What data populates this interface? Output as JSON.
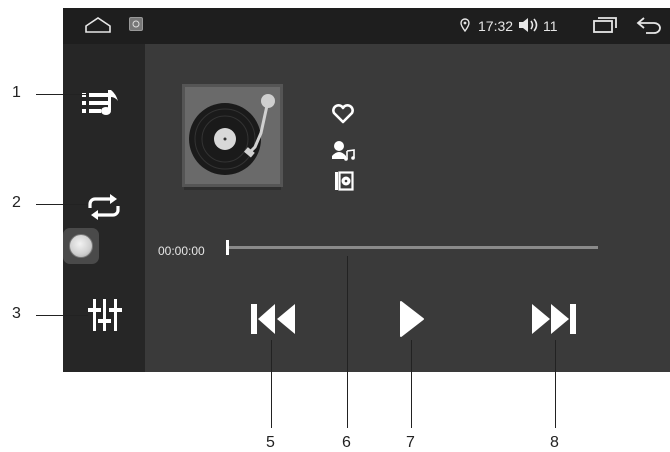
{
  "status_bar": {
    "time": "17:32",
    "volume": "11",
    "icons": [
      "home-icon",
      "app-icon",
      "location-icon",
      "volume-icon",
      "recent-apps-icon",
      "back-icon"
    ]
  },
  "sidebar": {
    "items": [
      {
        "name": "playlist",
        "icon": "playlist-icon"
      },
      {
        "name": "repeat",
        "icon": "repeat-icon"
      },
      {
        "name": "assistive-touch",
        "icon": "assistive-touch-icon"
      },
      {
        "name": "equalizer",
        "icon": "equalizer-icon"
      }
    ]
  },
  "track": {
    "album_art": "vinyl-record-icon",
    "actions": [
      "favorite-heart-icon",
      "artist-icon",
      "album-icon"
    ]
  },
  "progress": {
    "elapsed": "00:00:00",
    "fraction": 0.0
  },
  "controls": [
    "previous-track-icon",
    "play-icon",
    "next-track-icon"
  ],
  "callouts": {
    "c1": "1",
    "c2": "2",
    "c3": "3",
    "c5": "5",
    "c6": "6",
    "c7": "7",
    "c8": "8"
  },
  "colors": {
    "status_bar_bg": "#1e1e1e",
    "sidebar_bg": "#262626",
    "main_bg": "#3a3a3a",
    "icon": "#ffffff",
    "progress_track": "#8a8a8a"
  }
}
